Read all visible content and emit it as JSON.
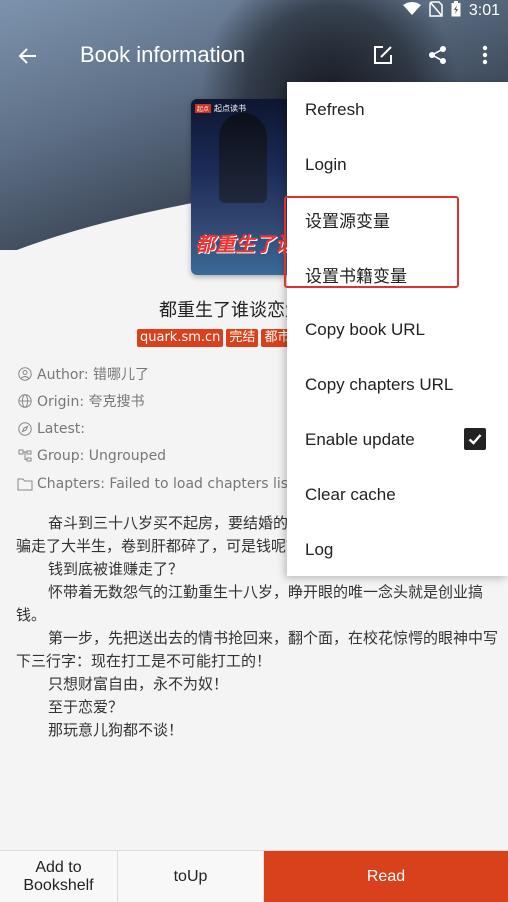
{
  "status_bar": {
    "time": "3:01"
  },
  "toolbar": {
    "title": "Book information",
    "icons": [
      "back-arrow-icon",
      "edit-icon",
      "share-icon",
      "more-vert-icon"
    ]
  },
  "cover": {
    "publisher_tag": "起点",
    "publisher_name": "起点读书",
    "title_art": "都重生了谁谈恋爱"
  },
  "book": {
    "name": "都重生了谁谈恋爱啊",
    "tags": [
      "quark.sm.cn",
      "完结",
      "都市"
    ]
  },
  "info": {
    "author": "Author: 错哪儿了",
    "origin": "Origin: 夸克搜书",
    "latest": "Latest:",
    "group": "Group: Ungrouped",
    "chapters": "Chapters: Failed to load chapters list"
  },
  "intro": {
    "lines": [
      "奋斗到三十八岁买不起房，要结婚的时候，女朋友跟人跑了，钱也被骗走了大半生，卷到肝都碎了，可是钱呢？",
      "钱到底被谁赚走了？",
      "怀带着无数怨气的江勤重生十八岁，睁开眼的唯一念头就是创业搞钱。",
      "第一步，先把送出去的情书抢回来，翻个面，在校花惊愕的眼神中写下三行字：现在打工是不可能打工的！",
      "只想财富自由，永不为奴！",
      "至于恋爱？",
      "那玩意儿狗都不谈！"
    ]
  },
  "bottom_bar": {
    "add_label": "Add to Bookshelf",
    "up_label": "toUp",
    "read_label": "Read"
  },
  "menu": {
    "items": [
      {
        "label": "Refresh"
      },
      {
        "label": "Login"
      },
      {
        "label": "设置源变量"
      },
      {
        "label": "设置书籍变量"
      },
      {
        "label": "Copy book URL"
      },
      {
        "label": "Copy chapters URL"
      },
      {
        "label": "Enable update",
        "checked": true
      },
      {
        "label": "Clear cache"
      },
      {
        "label": "Log"
      }
    ]
  },
  "colors": {
    "accent": "#d8411b",
    "highlight": "#e03030"
  }
}
